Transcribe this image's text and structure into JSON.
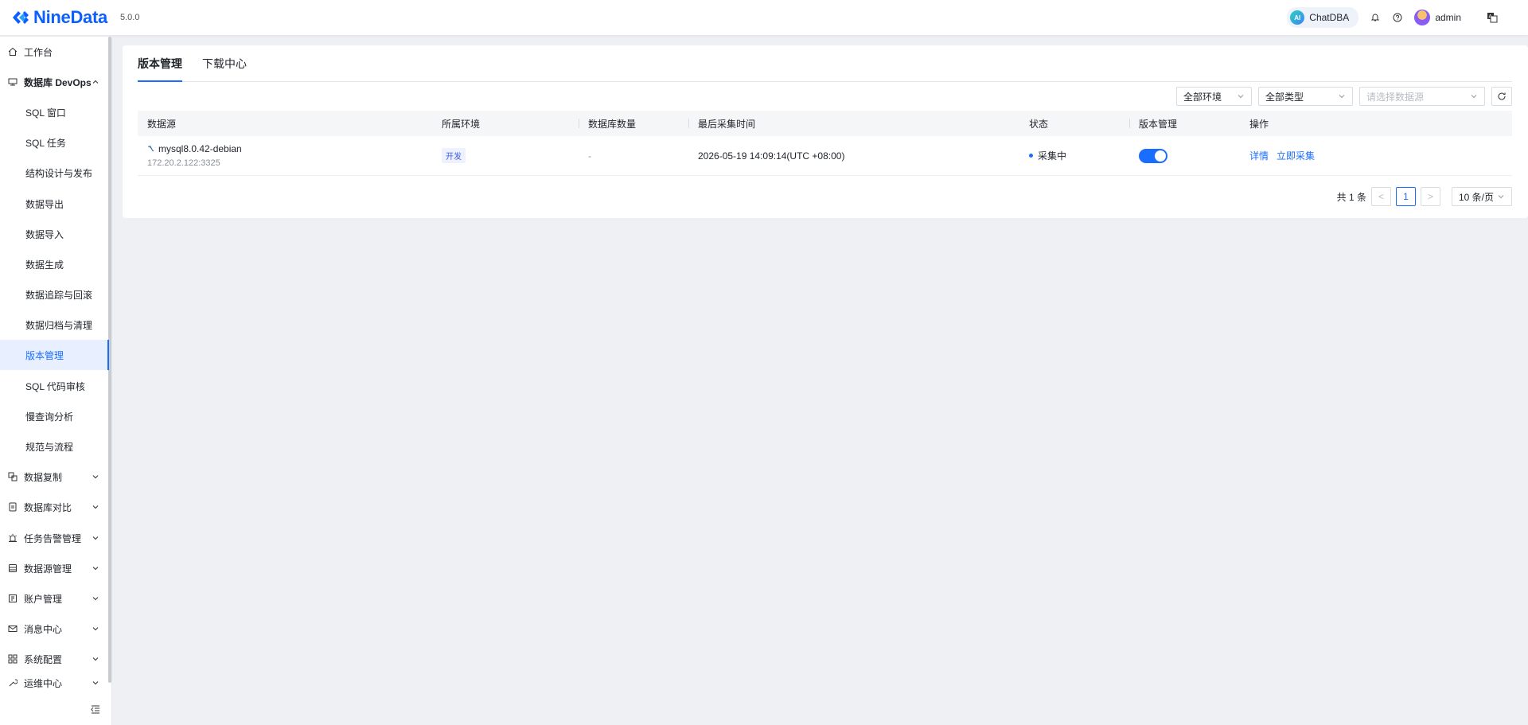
{
  "header": {
    "logo_text": "NineData",
    "version": "5.0.0",
    "chatdba_badge": "AI",
    "chatdba_label": "ChatDBA",
    "username": "admin"
  },
  "sidebar": {
    "items": [
      {
        "label": "工作台",
        "icon": "home-icon"
      },
      {
        "label": "数据库 DevOps",
        "icon": "database-devops-icon",
        "expanded": true
      },
      {
        "label": "数据复制",
        "icon": "replication-icon"
      },
      {
        "label": "数据库对比",
        "icon": "compare-icon"
      },
      {
        "label": "任务告警管理",
        "icon": "alarm-icon"
      },
      {
        "label": "数据源管理",
        "icon": "datasource-icon"
      },
      {
        "label": "账户管理",
        "icon": "account-icon"
      },
      {
        "label": "消息中心",
        "icon": "mail-icon"
      },
      {
        "label": "系统配置",
        "icon": "grid-icon"
      },
      {
        "label": "运维中心",
        "icon": "tool-icon"
      }
    ],
    "sub_items": [
      "SQL 窗口",
      "SQL 任务",
      "结构设计与发布",
      "数据导出",
      "数据导入",
      "数据生成",
      "数据追踪与回滚",
      "数据归档与清理",
      "版本管理",
      "SQL 代码审核",
      "慢查询分析",
      "规范与流程"
    ],
    "active_sub": "版本管理"
  },
  "tabs": [
    "版本管理",
    "下载中心"
  ],
  "filters": {
    "env": "全部环境",
    "type": "全部类型",
    "datasource_placeholder": "请选择数据源"
  },
  "table": {
    "columns": [
      "数据源",
      "所属环境",
      "数据库数量",
      "最后采集时间",
      "状态",
      "版本管理",
      "操作"
    ],
    "rows": [
      {
        "name": "mysql8.0.42-debian",
        "address": "172.20.2.122:3325",
        "env": "开发",
        "db_count": "-",
        "last_collect": "2026-05-19 14:09:14(UTC +08:00)",
        "status": "采集中",
        "version_enabled": true,
        "actions": [
          "详情",
          "立即采集"
        ]
      }
    ]
  },
  "pagination": {
    "total": "共 1 条",
    "prev": "<",
    "current": "1",
    "next": ">",
    "page_size": "10 条/页"
  },
  "colors": {
    "accent": "#1a6dff",
    "brand": "#0b5fff"
  }
}
